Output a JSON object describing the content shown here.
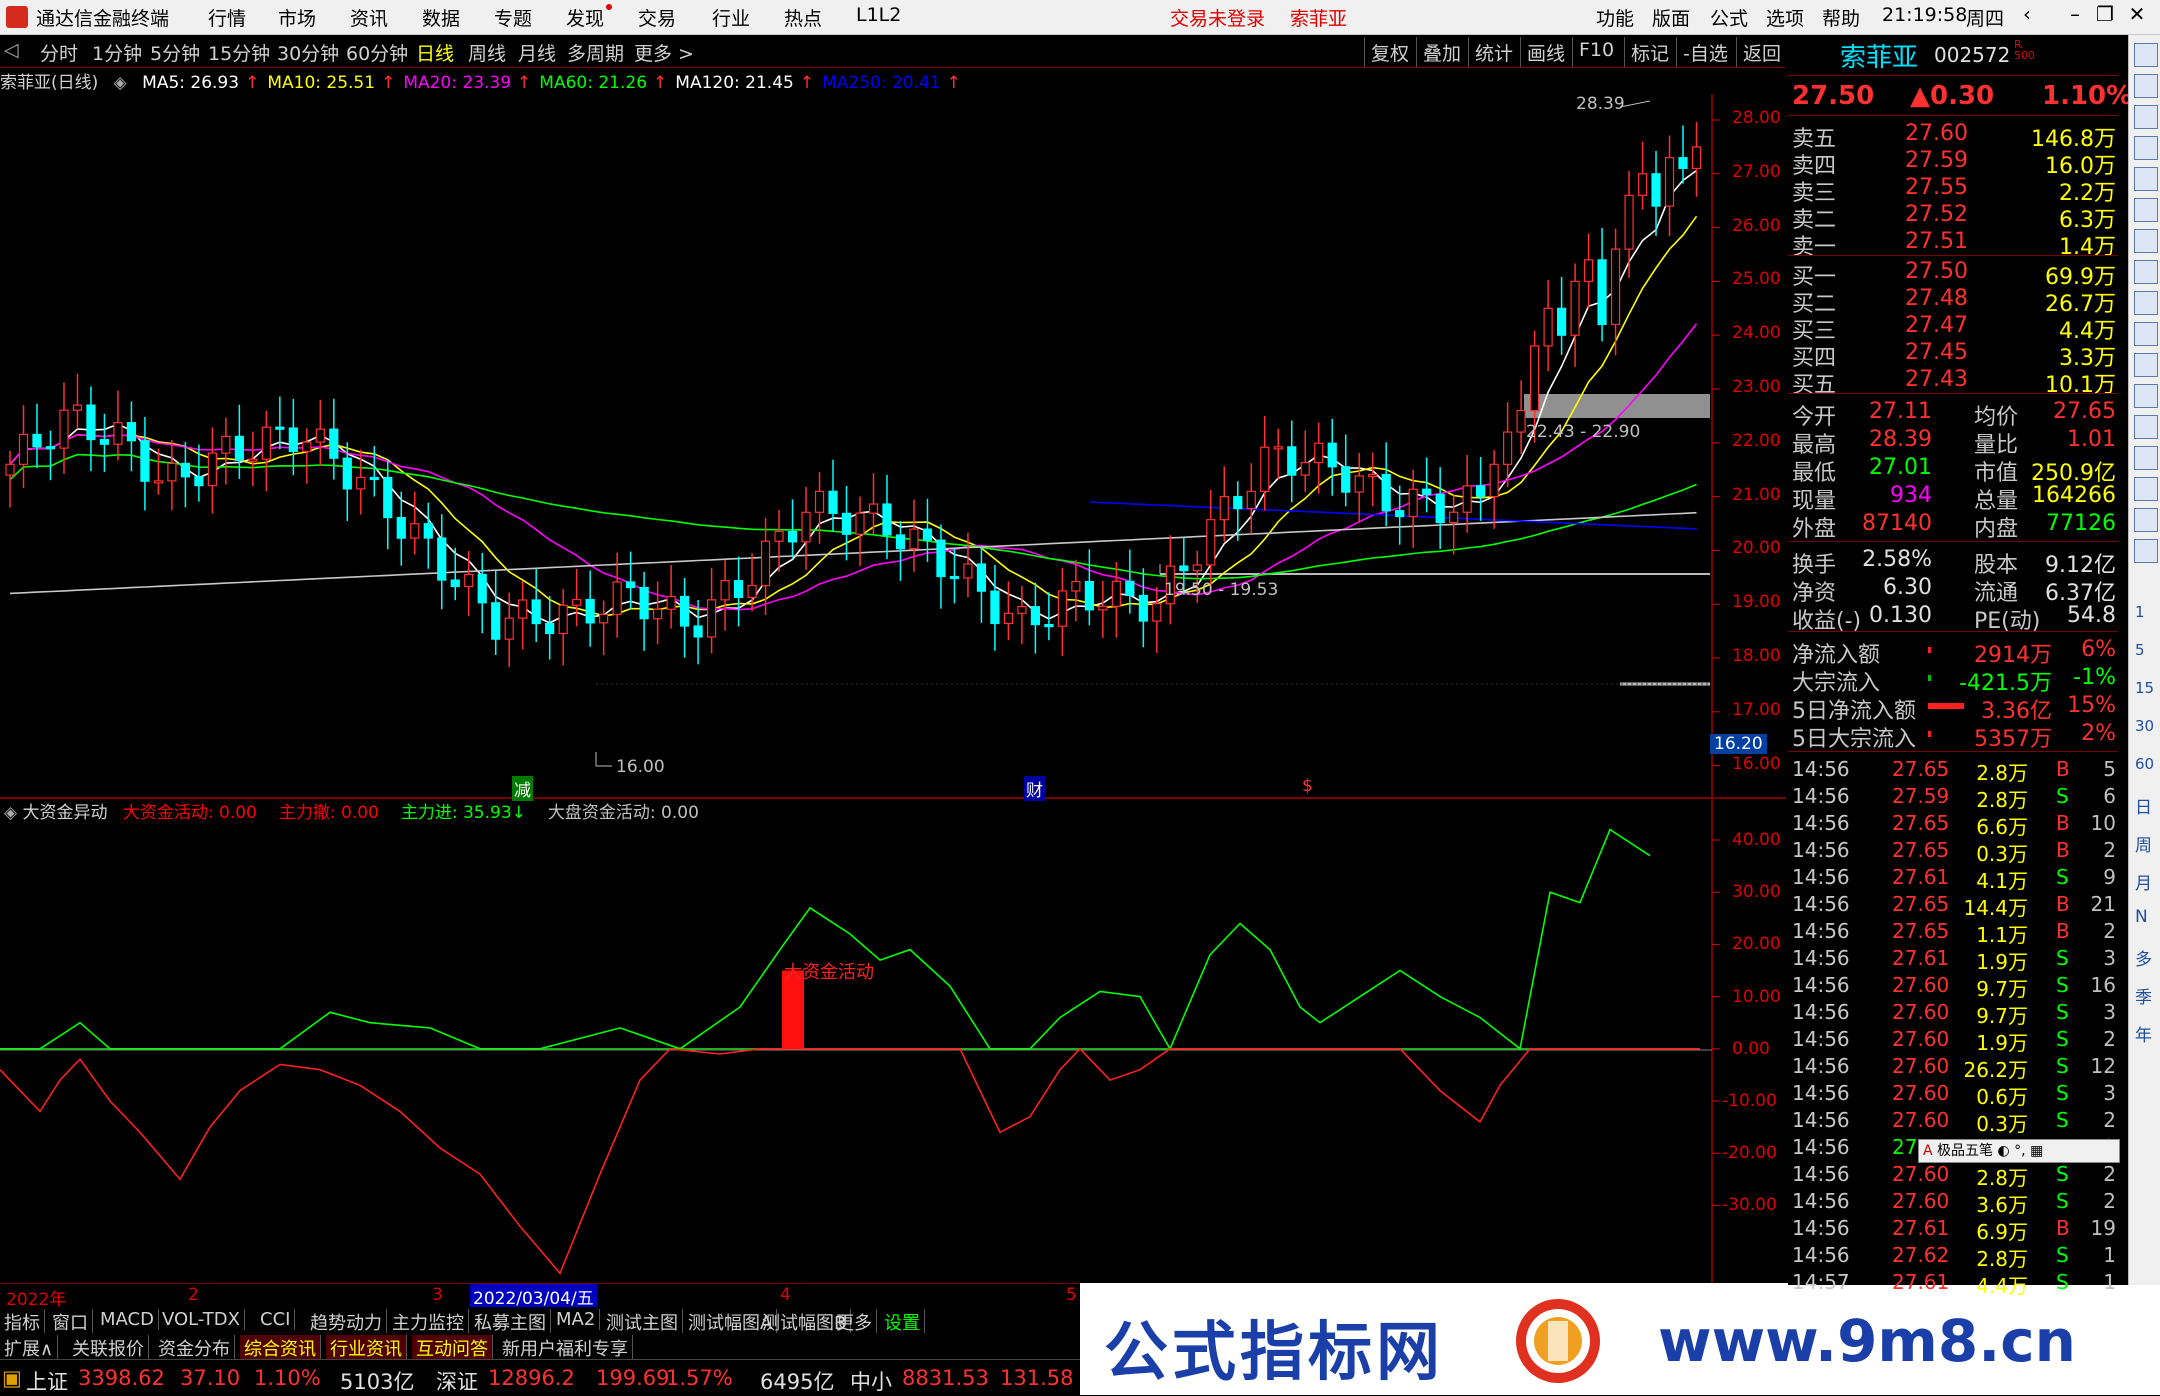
{
  "titlebar": {
    "app_name": "通达信金融终端",
    "menus": [
      "行情",
      "市场",
      "资讯",
      "数据",
      "专题",
      "发现",
      "交易",
      "行业",
      "热点",
      "L1L2"
    ],
    "login_status": "交易未登录",
    "stock_name": "索菲亚",
    "right_menus": [
      "功能",
      "版面",
      "公式",
      "选项",
      "帮助"
    ],
    "clock": "21:19:58",
    "weekday": "周四"
  },
  "periodbar": {
    "periods": [
      "分时",
      "1分钟",
      "5分钟",
      "15分钟",
      "30分钟",
      "60分钟",
      "日线",
      "周线",
      "月线",
      "多周期",
      "更多 >"
    ],
    "active": "日线",
    "tools": [
      "复权",
      "叠加",
      "统计",
      "画线",
      "F10",
      "标记",
      "-自选",
      "返回"
    ]
  },
  "ma_legend": {
    "title": "索菲亚(日线)",
    "items": [
      {
        "label": "MA5: 26.93",
        "color": "#ffffff"
      },
      {
        "label": "MA10: 25.51",
        "color": "#ffff00"
      },
      {
        "label": "MA20: 23.39",
        "color": "#ff00ff"
      },
      {
        "label": "MA60: 21.26",
        "color": "#00ff00"
      },
      {
        "label": "MA120: 21.45",
        "color": "#ffffff"
      },
      {
        "label": "MA250: 20.41",
        "color": "#0000ff"
      }
    ]
  },
  "chart_data": {
    "type": "candlestick",
    "price_axis": {
      "ticks": [
        "28.00",
        "27.00",
        "26.00",
        "25.00",
        "24.00",
        "23.00",
        "22.00",
        "21.00",
        "20.00",
        "19.00",
        "18.00",
        "17.00",
        "16.00"
      ],
      "current": "16.20"
    },
    "annotations": {
      "high": "28.39",
      "low": "16.00",
      "gap_upper": "22.43 - 22.90",
      "gap_lower": "19.50 - 19.53"
    },
    "event_markers": [
      "减",
      "财",
      "$"
    ],
    "indicator": {
      "title": "大资金异动",
      "labels": [
        {
          "text": "大资金活动: 0.00",
          "color": "#ff0000"
        },
        {
          "text": "主力撤: 0.00",
          "color": "#ff0000"
        },
        {
          "text": "主力进: 35.93↓",
          "color": "#00ff00"
        },
        {
          "text": "大盘资金活动: 0.00",
          "color": "#c0c0c0"
        }
      ],
      "ticks": [
        "40.00",
        "30.00",
        "20.00",
        "10.00",
        "0.00",
        "-10.00",
        "-20.00",
        "-30.00"
      ],
      "bar_label": "大资金活动"
    },
    "date_axis": [
      "2022年",
      "2",
      "3",
      "2022/03/04/五",
      "4",
      "5"
    ]
  },
  "quote": {
    "name": "索菲亚",
    "code": "002572",
    "price": "27.50",
    "change": "▲0.30",
    "pct": "1.10%",
    "asks": [
      [
        "卖五",
        "27.60",
        "146.8万"
      ],
      [
        "卖四",
        "27.59",
        "16.0万"
      ],
      [
        "卖三",
        "27.55",
        "2.2万"
      ],
      [
        "卖二",
        "27.52",
        "6.3万"
      ],
      [
        "卖一",
        "27.51",
        "1.4万"
      ]
    ],
    "bids": [
      [
        "买一",
        "27.50",
        "69.9万"
      ],
      [
        "买二",
        "27.48",
        "26.7万"
      ],
      [
        "买三",
        "27.47",
        "4.4万"
      ],
      [
        "买四",
        "27.45",
        "3.3万"
      ],
      [
        "买五",
        "27.43",
        "10.1万"
      ]
    ],
    "stats": [
      [
        "今开",
        "27.11",
        "均价",
        "27.65"
      ],
      [
        "最高",
        "28.39",
        "量比",
        "1.01"
      ],
      [
        "最低",
        "27.01",
        "市值",
        "250.9亿"
      ],
      [
        "现量",
        "934",
        "总量",
        "164266"
      ],
      [
        "外盘",
        "87140",
        "内盘",
        "77126"
      ]
    ],
    "stats2": [
      [
        "换手",
        "2.58%",
        "股本",
        "9.12亿"
      ],
      [
        "净资",
        "6.30",
        "流通",
        "6.37亿"
      ],
      [
        "收益(-)",
        "0.130",
        "PE(动)",
        "54.8"
      ]
    ],
    "flows": [
      [
        "净流入额",
        "2914万",
        "6%"
      ],
      [
        "大宗流入",
        "-421.5万",
        "-1%"
      ],
      [
        "5日净流入额",
        "3.36亿",
        "15%"
      ],
      [
        "5日大宗流入",
        "5357万",
        "2%"
      ]
    ]
  },
  "ticks": [
    [
      "14:56",
      "27.65",
      "2.8万",
      "B",
      "5"
    ],
    [
      "14:56",
      "27.59",
      "2.8万",
      "S",
      "6"
    ],
    [
      "14:56",
      "27.65",
      "6.6万",
      "B",
      "10"
    ],
    [
      "14:56",
      "27.65",
      "0.3万",
      "B",
      "2"
    ],
    [
      "14:56",
      "27.61",
      "4.1万",
      "S",
      "9"
    ],
    [
      "14:56",
      "27.65",
      "14.4万",
      "B",
      "21"
    ],
    [
      "14:56",
      "27.65",
      "1.1万",
      "B",
      "2"
    ],
    [
      "14:56",
      "27.61",
      "1.9万",
      "S",
      "3"
    ],
    [
      "14:56",
      "27.60",
      "9.7万",
      "S",
      "16"
    ],
    [
      "14:56",
      "27.60",
      "9.7万",
      "S",
      "3"
    ],
    [
      "14:56",
      "27.60",
      "1.9万",
      "S",
      "2"
    ],
    [
      "14:56",
      "27.60",
      "26.2万",
      "S",
      "12"
    ],
    [
      "14:56",
      "27.60",
      "0.6万",
      "S",
      "3"
    ],
    [
      "14:56",
      "27.60",
      "0.3万",
      "S",
      "2"
    ],
    [
      "14:56",
      "27",
      "",
      "",
      "2"
    ],
    [
      "14:56",
      "27.60",
      "2.8万",
      "S",
      "2"
    ],
    [
      "14:56",
      "27.60",
      "3.6万",
      "S",
      "2"
    ],
    [
      "14:56",
      "27.61",
      "6.9万",
      "B",
      "19"
    ],
    [
      "14:56",
      "27.62",
      "2.8万",
      "S",
      "1"
    ],
    [
      "14:57",
      "27.61",
      "4.4万",
      "S",
      "1"
    ]
  ],
  "popup": "极品五笔",
  "sidebar": {
    "labels": [
      "日",
      "周",
      "月",
      "N",
      "多",
      "季",
      "年"
    ],
    "nums": [
      "1",
      "5",
      "15",
      "30",
      "60"
    ]
  },
  "tabs1": [
    "指标",
    "窗口",
    "MACD",
    "VOL-TDX",
    "CCI",
    "趋势动力",
    "主力监控",
    "私募主图",
    "MA2",
    "测试主图",
    "测试幅图A",
    "测试幅图B",
    "更多",
    "设置"
  ],
  "tabs2": [
    "扩展∧",
    "关联报价",
    "资金分布",
    "综合资讯",
    "行业资讯",
    "互动问答",
    "新用户福利专享"
  ],
  "status": {
    "sh_label": "上证",
    "sh_val": "3398.62",
    "sh_chg": "37.10",
    "sh_pct": "1.10%",
    "sh_amt": "5103亿",
    "sz_label": "深证",
    "sz_val": "12896.2",
    "sz_chg": "199.69",
    "sz_pct": "1.57%",
    "sz_amt": "6495亿",
    "zx_label": "中小",
    "zx_val": "8831.53",
    "zx_chg": "131.58"
  },
  "watermark": {
    "text": "公式指标网",
    "url": "www.9m8.cn"
  }
}
